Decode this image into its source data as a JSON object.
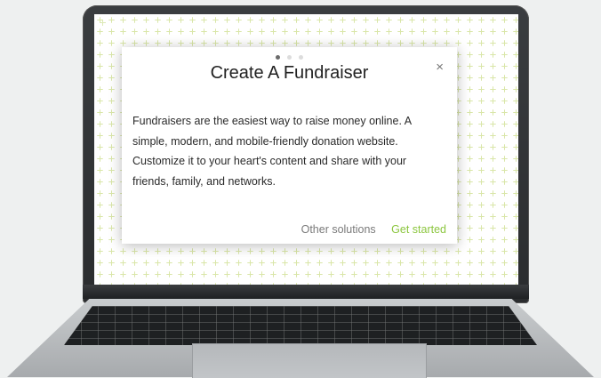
{
  "modal": {
    "title": "Create A Fundraiser",
    "close_icon": "×",
    "body": "Fundraisers are the easiest way to raise money online. A simple, modern, and mobile-friendly donation website. Customize it to your heart's content and share with your friends, family, and networks.",
    "carousel": {
      "total": 3,
      "active": 1
    },
    "secondary_action": "Other solutions",
    "primary_action": "Get started"
  },
  "colors": {
    "accent": "#8cc63f",
    "pattern": "#d9e6a8",
    "lid": "#2e3033",
    "body": "#b7babd"
  },
  "icons": {
    "close": "close-icon"
  }
}
